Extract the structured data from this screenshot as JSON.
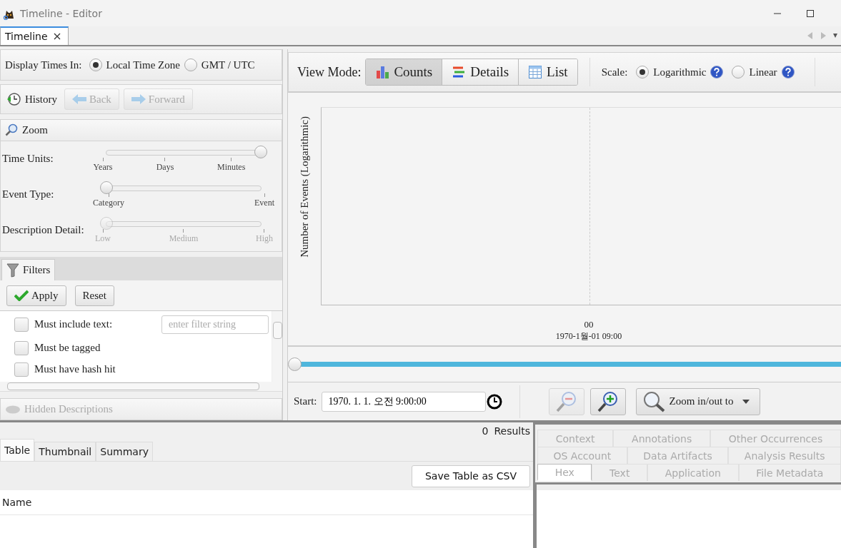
{
  "window": {
    "title": "Timeline - Editor"
  },
  "document_tabs": [
    {
      "label": "Timeline",
      "selected": true
    }
  ],
  "display_times": {
    "label": "Display Times In:",
    "options": [
      {
        "label": "Local Time Zone",
        "selected": true
      },
      {
        "label": "GMT / UTC",
        "selected": false
      }
    ]
  },
  "history": {
    "label": "History",
    "buttons": [
      {
        "label": "Back",
        "kind": "back",
        "disabled": true
      },
      {
        "label": "Forward",
        "kind": "forward",
        "disabled": true
      }
    ]
  },
  "zoom": {
    "title": "Zoom",
    "sliders": [
      {
        "label": "Time Units:",
        "level": 1,
        "disabled": false,
        "tick_labels": [
          "Years",
          "Days",
          "Minutes"
        ]
      },
      {
        "label": "Event Type:",
        "level": 0,
        "disabled": false,
        "tick_labels": [
          "Category",
          "Event"
        ]
      },
      {
        "label": "Description Detail:",
        "level": 0,
        "disabled": true,
        "tick_labels": [
          "Low",
          "Medium",
          "High"
        ]
      }
    ]
  },
  "filters": {
    "tab": "Filters",
    "buttons": [
      {
        "label": "Apply",
        "kind": "apply"
      },
      {
        "label": "Reset",
        "kind": "plain"
      }
    ],
    "items": [
      {
        "label": "Must include text:",
        "checked": false,
        "kind": "text",
        "placeholder": "enter filter string"
      },
      {
        "label": "Must be tagged",
        "checked": false,
        "kind": "check"
      },
      {
        "label": "Must have hash hit",
        "checked": false,
        "kind": "check"
      }
    ]
  },
  "hidden_descriptions": {
    "label": "Hidden Descriptions",
    "disabled": true
  },
  "view_mode": {
    "label": "View Mode:",
    "modes": [
      {
        "label": "Counts",
        "kind": "counts",
        "selected": true
      },
      {
        "label": "Details",
        "kind": "details",
        "selected": false
      },
      {
        "label": "List",
        "kind": "list",
        "selected": false
      }
    ]
  },
  "scale": {
    "label": "Scale:",
    "options": [
      {
        "label": "Logarithmic",
        "selected": true
      },
      {
        "label": "Linear",
        "selected": false
      }
    ]
  },
  "chart": {
    "ylabel": "Number of Events (Logarithmic)",
    "x_tick": "00",
    "x_date": "1970-1월-01 09:00"
  },
  "start": {
    "label": "Start:",
    "value": "1970. 1. 1. 오전 9:00:00"
  },
  "zoom_controls": {
    "zoom_out_disabled": true,
    "zoom_in_disabled": false,
    "dropdown": "Zoom in/out to"
  },
  "results": {
    "count": "0",
    "label": "Results",
    "tabs": [
      {
        "label": "Table",
        "selected": true
      },
      {
        "label": "Thumbnail",
        "selected": false
      },
      {
        "label": "Summary",
        "selected": false
      }
    ],
    "button": "Save Table as CSV",
    "columns": [
      "Name"
    ]
  },
  "viewer_tabs": [
    [
      {
        "label": "Context",
        "selected": false,
        "disabled": true
      },
      {
        "label": "Annotations",
        "selected": false,
        "disabled": true
      },
      {
        "label": "Other Occurrences",
        "selected": false,
        "disabled": true
      }
    ],
    [
      {
        "label": "OS Account",
        "selected": false,
        "disabled": true
      },
      {
        "label": "Data Artifacts",
        "selected": false,
        "disabled": true
      },
      {
        "label": "Analysis Results",
        "selected": false,
        "disabled": true
      }
    ],
    [
      {
        "label": "Hex",
        "selected": true,
        "disabled": true
      },
      {
        "label": "Text",
        "selected": false,
        "disabled": true
      },
      {
        "label": "Application",
        "selected": false,
        "disabled": true
      },
      {
        "label": "File Metadata",
        "selected": false,
        "disabled": true
      }
    ]
  ]
}
